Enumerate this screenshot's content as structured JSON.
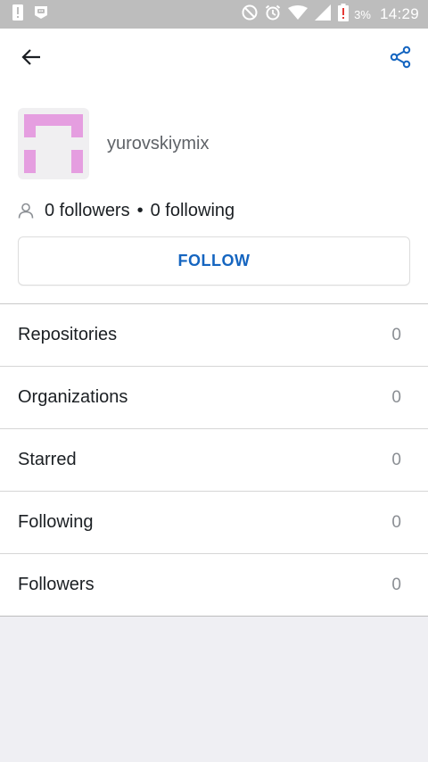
{
  "status_bar": {
    "battery_percent": "3%",
    "time": "14:29",
    "icons": [
      "sim-alert-icon",
      "app-notification-icon",
      "do-not-disturb-icon",
      "alarm-icon",
      "wifi-icon",
      "signal-icon",
      "battery-alert-icon"
    ]
  },
  "app_bar": {
    "back_icon": "arrow-left-icon",
    "share_icon": "share-icon",
    "accent_color": "#1565c0"
  },
  "profile": {
    "username": "yurovskiymix",
    "avatar_color": "#e59ee0",
    "followers_text": "0 followers",
    "separator": "•",
    "following_text": "0 following",
    "follow_button_label": "FOLLOW"
  },
  "menu": {
    "items": [
      {
        "label": "Repositories",
        "count": "0"
      },
      {
        "label": "Organizations",
        "count": "0"
      },
      {
        "label": "Starred",
        "count": "0"
      },
      {
        "label": "Following",
        "count": "0"
      },
      {
        "label": "Followers",
        "count": "0"
      }
    ]
  }
}
